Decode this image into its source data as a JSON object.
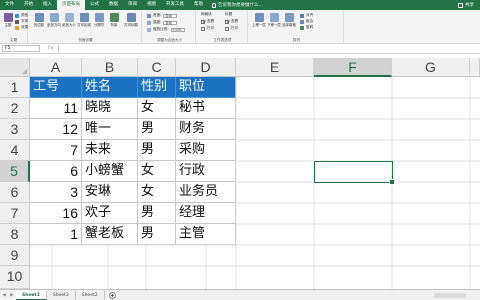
{
  "tabs": [
    "文件",
    "开始",
    "插入",
    "页面布局",
    "公式",
    "数据",
    "审阅",
    "视图",
    "开发工具",
    "帮助"
  ],
  "active_tab_index": 3,
  "tell_me": "告诉我你想要做什么...",
  "share": "共享",
  "ribbon": {
    "theme_group": {
      "buttons": [
        {
          "label": "主题",
          "color": "#7a5fa0"
        },
        {
          "label": "颜色",
          "color": "#3d8bd6"
        },
        {
          "label": "字体",
          "color": "#5a5a5a"
        },
        {
          "label": "效果",
          "color": "#e0a030"
        }
      ],
      "label": "主题"
    },
    "page_setup_group": {
      "buttons": [
        {
          "label": "页边距",
          "color": "#6d8fbf"
        },
        {
          "label": "纸张方向",
          "color": "#8aa7cf"
        },
        {
          "label": "纸张大小",
          "color": "#98b1d4"
        },
        {
          "label": "打印区域",
          "color": "#6c8db8"
        },
        {
          "label": "分隔符",
          "color": "#7e9ac2"
        },
        {
          "label": "背景",
          "color": "#4f8a5c"
        },
        {
          "label": "打印标题",
          "color": "#6b88b3"
        }
      ],
      "label": "页面设置"
    },
    "scale_group": {
      "width_label": "宽度:",
      "width_value": "自动",
      "height_label": "高度:",
      "height_value": "自动",
      "scale_label": "缩放比例:",
      "scale_value": "100%",
      "label": "调整为合适大小"
    },
    "sheet_options_group": {
      "gridlines": "网格线",
      "headings": "标题",
      "view_gridlines": "查看",
      "view_headings": "查看",
      "print_gridlines": "打印",
      "print_headings": "打印",
      "label": "工作表选项"
    },
    "arrange_group": {
      "buttons": [
        {
          "label": "上移一层",
          "color": "#6d8fbf"
        },
        {
          "label": "下移一层",
          "color": "#8aa7cf"
        },
        {
          "label": "选择窗格",
          "color": "#7e9ac2"
        },
        {
          "label": "对齐",
          "color": "#5a7cac"
        },
        {
          "label": "组合",
          "color": "#6b88b3"
        },
        {
          "label": "旋转",
          "color": "#4f8a5c"
        }
      ],
      "label": "排列"
    }
  },
  "formula_bar": {
    "name_box": "F5",
    "fx": "fx",
    "formula": ""
  },
  "grid": {
    "columns": [
      "A",
      "B",
      "C",
      "D",
      "E",
      "F",
      "G"
    ],
    "rows": [
      "1",
      "2",
      "3",
      "4",
      "5",
      "6",
      "7",
      "8",
      "9",
      "10"
    ],
    "selected_column": "F",
    "selected_row": "5",
    "header_fill": "#1b72c2",
    "table_header": [
      "工号",
      "姓名",
      "性别",
      "职位"
    ],
    "table_rows": [
      [
        "11",
        "晓晓",
        "女",
        "秘书"
      ],
      [
        "12",
        "唯一",
        "男",
        "财务"
      ],
      [
        "7",
        "未来",
        "男",
        "采购"
      ],
      [
        "6",
        "小螃蟹",
        "女",
        "行政"
      ],
      [
        "3",
        "安琳",
        "女",
        "业务员"
      ],
      [
        "16",
        "欢子",
        "男",
        "经理"
      ],
      [
        "1",
        "蟹老板",
        "男",
        "主管"
      ]
    ]
  },
  "sheets": [
    "Sheet1",
    "Sheet3",
    "Sheet2"
  ],
  "active_sheet_index": 0,
  "accent_color": "#217346"
}
